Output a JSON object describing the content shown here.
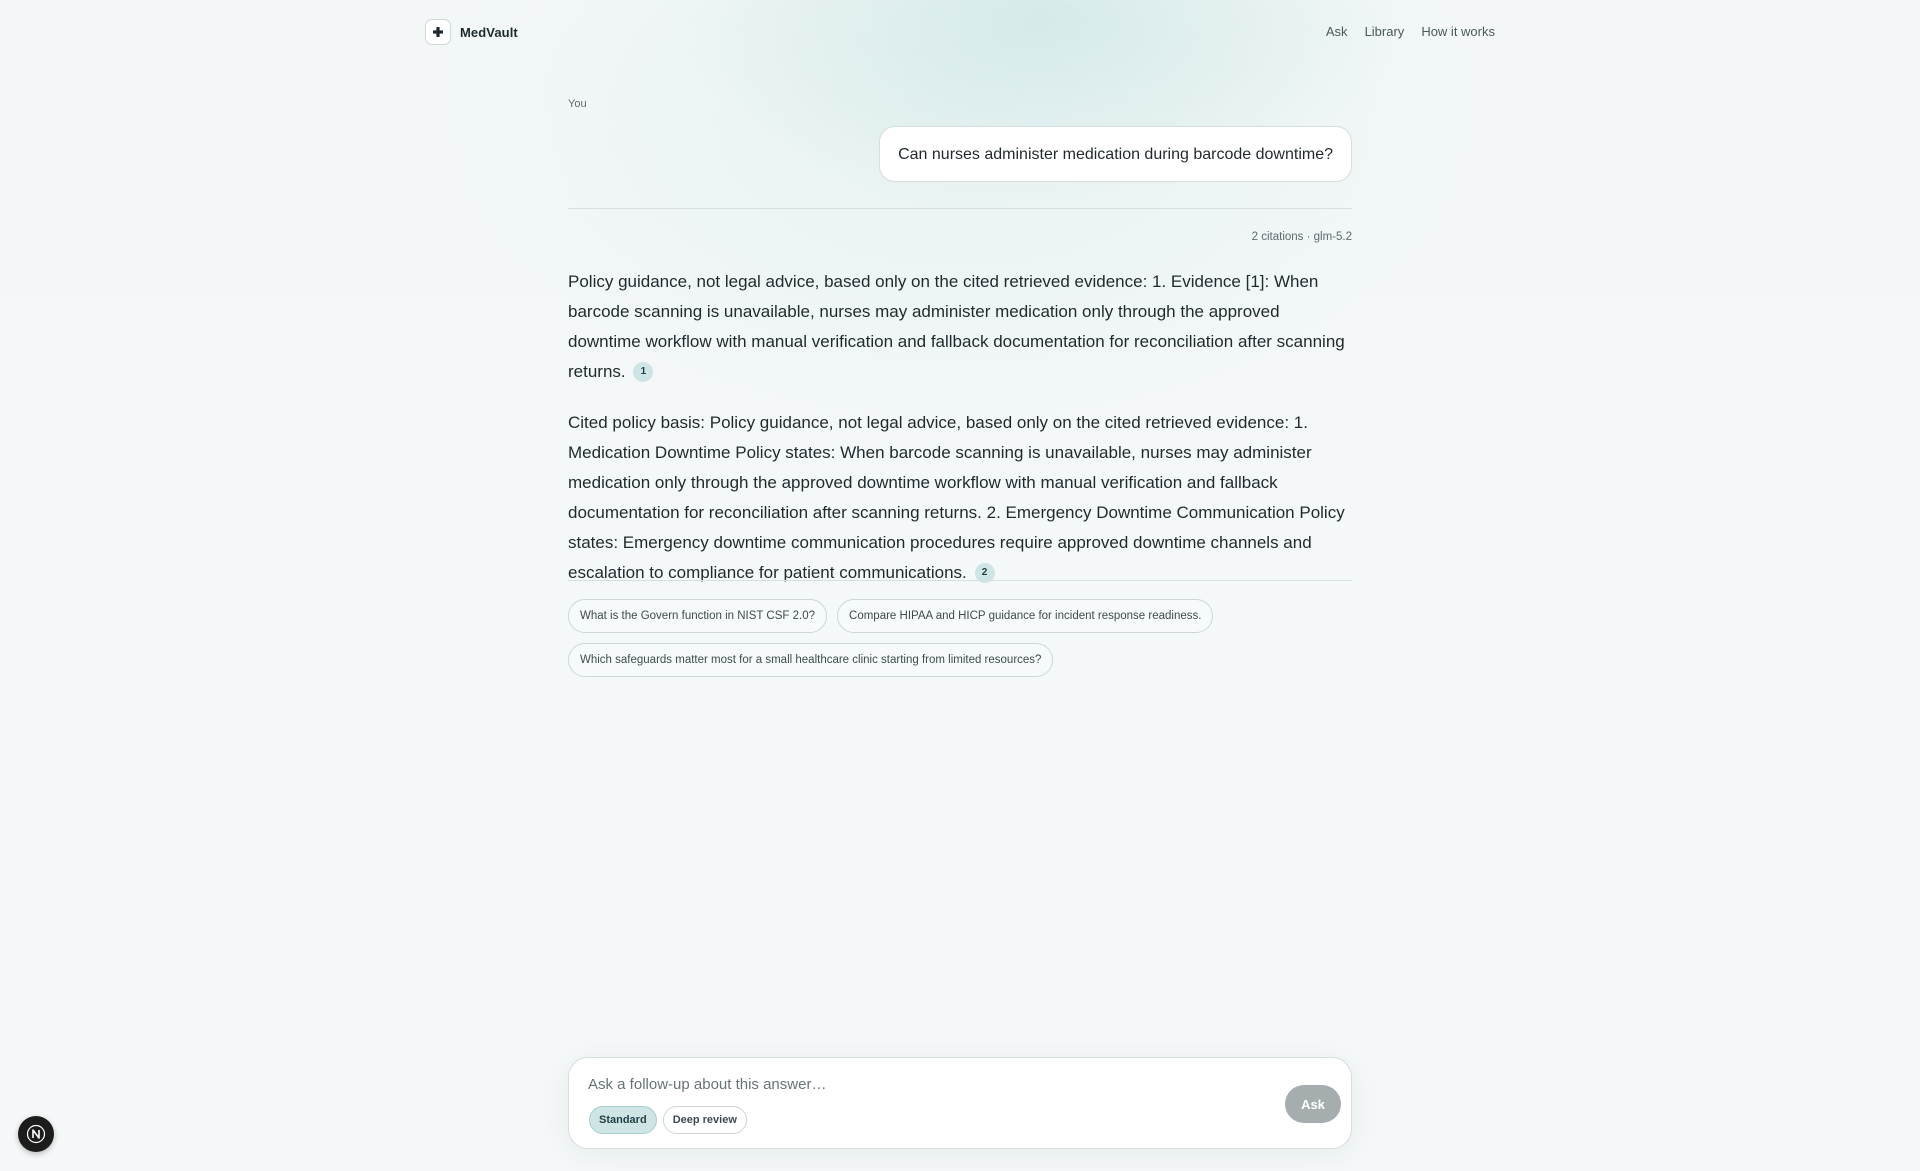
{
  "app": {
    "name": "MedVault",
    "logo_icon": "plus-icon"
  },
  "nav": {
    "items": [
      "Ask",
      "Library",
      "How it works"
    ]
  },
  "conversation": {
    "user_label": "You",
    "user_question": "Can nurses administer medication during barcode downtime?",
    "meta": "2 citations · glm-5.2",
    "answer_paragraphs": [
      {
        "text": "Policy guidance, not legal advice, based only on the cited retrieved evidence: 1. Evidence [1]: When barcode scanning is unavailable, nurses may administer medication only through the approved downtime workflow with manual verification and fallback documentation for reconciliation after scanning returns.",
        "citation": "1"
      },
      {
        "text": "Cited policy basis: Policy guidance, not legal advice, based only on the cited retrieved evidence: 1. Medication Downtime Policy states: When barcode scanning is unavailable, nurses may administer medication only through the approved downtime workflow with manual verification and fallback documentation for reconciliation after scanning returns. 2. Emergency Downtime Communication Policy states: Emergency downtime communication procedures require approved downtime channels and escalation to compliance for patient communications.",
        "citation": "2"
      }
    ],
    "suggestions": [
      "What is the Govern function in NIST CSF 2.0?",
      "Compare HIPAA and HICP guidance for incident response readiness.",
      "Which safeguards matter most for a small healthcare clinic starting from limited resources?"
    ]
  },
  "composer": {
    "placeholder": "Ask a follow-up about this answer…",
    "value": "",
    "modes": [
      {
        "label": "Standard",
        "selected": true
      },
      {
        "label": "Deep review",
        "selected": false
      }
    ],
    "submit_label": "Ask"
  },
  "dev_badge": {
    "letter": "N"
  },
  "colors": {
    "accent_chip": "#cfe5e5",
    "ask_button_disabled": "#a6adaf",
    "text": "#1f2a2e"
  }
}
